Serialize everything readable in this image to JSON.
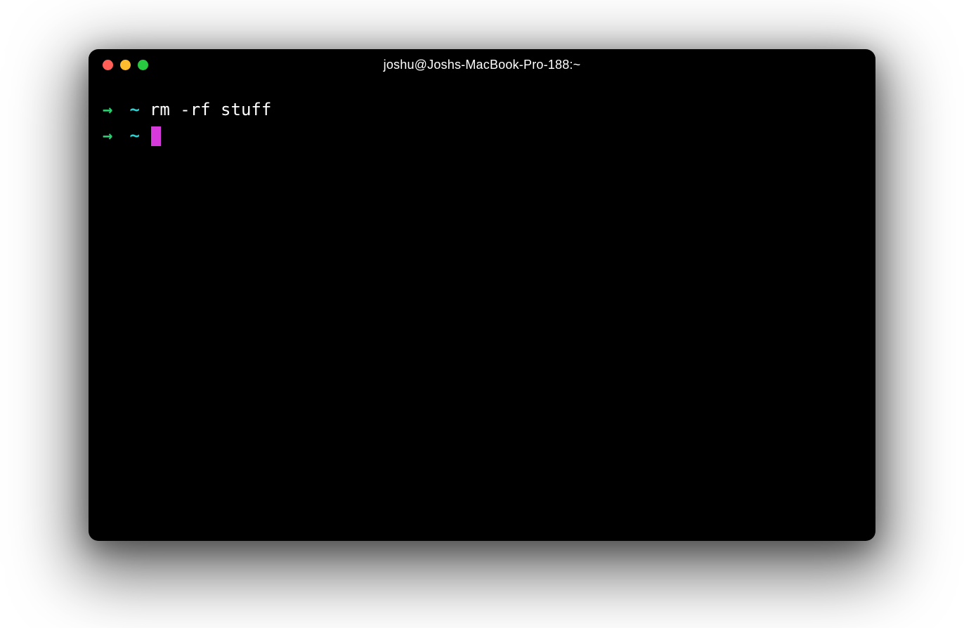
{
  "window": {
    "title": "joshu@Joshs-MacBook-Pro-188:~"
  },
  "colors": {
    "traffic_red": "#ff5f57",
    "traffic_yellow": "#febc2e",
    "traffic_green": "#28c840",
    "prompt_arrow": "#2ecc71",
    "prompt_path": "#2ad1d1",
    "command_text": "#ffffff",
    "cursor": "#d63adb",
    "background": "#000000"
  },
  "terminal": {
    "lines": [
      {
        "arrow": "→",
        "path": "~",
        "command": "rm -rf stuff",
        "has_cursor": false
      },
      {
        "arrow": "→",
        "path": "~",
        "command": "",
        "has_cursor": true
      }
    ]
  }
}
